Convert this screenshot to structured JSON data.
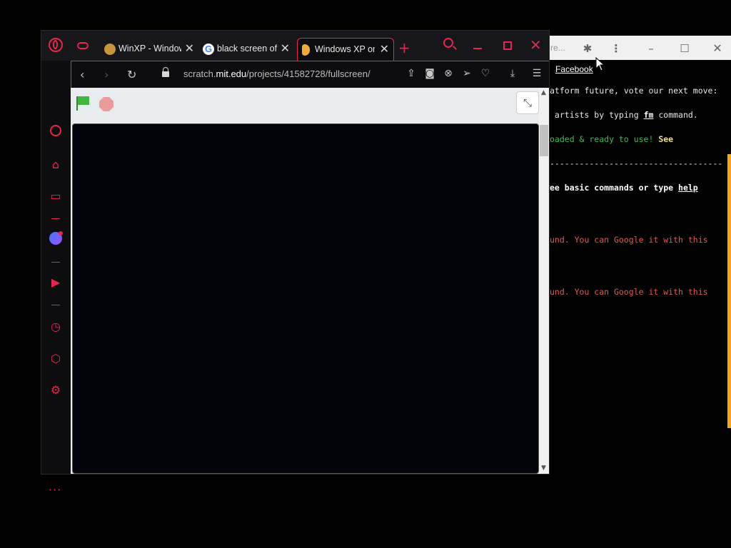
{
  "background_window": {
    "tab_fragment": "re...",
    "bookmark": "Facebook",
    "icons": [
      "puzzle-icon",
      "more-vert-icon",
      "minimize-icon",
      "maximize-icon",
      "close-icon"
    ],
    "terminal": {
      "line1": "atform future, vote our next move:",
      "line2_a": " artists by typing ",
      "line2_cmd": "fm",
      "line2_b": " command.",
      "line3_green": "oaded & ready to use! ",
      "line3_see": "See",
      "separator": "-----------------------------------",
      "line4_a": "ee basic commands or type ",
      "line4_help": "help",
      "error1": "und. You can Google it with this",
      "error2": "und. You can Google it with this"
    },
    "accent_bar_color": "#f5a623"
  },
  "opera": {
    "accent_color": "#e6264d",
    "tabs": [
      {
        "label": "WinXP - Windows",
        "active": false
      },
      {
        "label": "black screen of death",
        "active": false
      },
      {
        "label": "Windows XP on",
        "active": true
      }
    ],
    "new_tab_label": "+",
    "address": {
      "url_prefix": "scratch.",
      "url_domain": "mit.edu",
      "url_path": "/projects/41582728/fullscreen/"
    },
    "sidebar_icons": [
      "speed-dial-icon",
      "bag-icon",
      "twitch-icon",
      "messenger-icon",
      "player-icon",
      "history-icon",
      "cube-icon",
      "settings-icon"
    ],
    "sidebar_more": "···"
  },
  "scratch": {
    "exit_fullscreen_icon": "compress-icon",
    "stage_color": "#03030c"
  }
}
